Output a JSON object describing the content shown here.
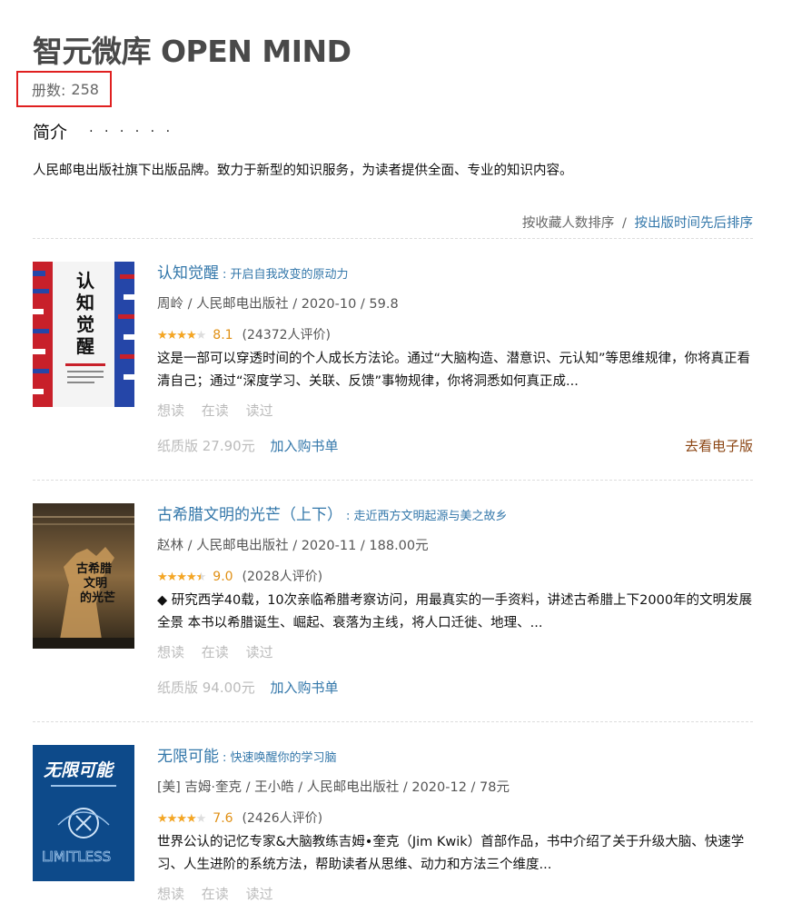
{
  "header": {
    "title": "智元微库 OPEN MIND",
    "count_label": "册数:",
    "count_value": "258",
    "intro_label": "简介",
    "intro_more": "· · · · · ·",
    "description": "人民邮电出版社旗下出版品牌。致力于新型的知识服务，为读者提供全面、专业的知识内容。"
  },
  "sort": {
    "option_1": "按收藏人数排序",
    "separator": "/",
    "option_2": "按出版时间先后排序"
  },
  "books": [
    {
      "title": "认知觉醒",
      "subtitle": ": 开启自我改变的原动力",
      "pub": "周岭 / 人民邮电出版社 / 2020-10 / 59.8",
      "stars": 4,
      "score": "8.1",
      "votes": "(24372人评价)",
      "intro": "这是一部可以穿透时间的个人成长方法论。通过“大脑构造、潜意识、元认知”等思维规律，你将真正看清自己；通过“深度学习、关联、反馈”事物规律，你将洞悉如何真正成...",
      "actions": [
        "想读",
        "在读",
        "读过"
      ],
      "paper": "纸质版 27.90元",
      "cart": "加入购书单",
      "ebook": "去看电子版",
      "cover_text": "认知觉醒"
    },
    {
      "title": "古希腊文明的光芒（上下）",
      "subtitle": ": 走近西方文明起源与美之故乡",
      "pub": "赵林 / 人民邮电出版社 / 2020-11 / 188.00元",
      "stars": 4.5,
      "score": "9.0",
      "votes": "(2028人评价)",
      "intro": "◆ 研究西学40载，10次亲临希腊考察访问，用最真实的一手资料，讲述古希腊上下2000年的文明发展全景 本书以希腊诞生、崛起、衰落为主线，将人口迁徙、地理、...",
      "actions": [
        "想读",
        "在读",
        "读过"
      ],
      "paper": "纸质版 94.00元",
      "cart": "加入购书单",
      "cover_text": "古希腊文明的光芒"
    },
    {
      "title": "无限可能",
      "subtitle": ": 快速唤醒你的学习脑",
      "pub": "[美] 吉姆·奎克 / 王小皓 / 人民邮电出版社 / 2020-12 / 78元",
      "stars": 4,
      "score": "7.6",
      "votes": "(2426人评价)",
      "intro": "世界公认的记忆专家&大脑教练吉姆•奎克（Jim Kwik）首部作品，书中介绍了关于升级大脑、快速学习、人生进阶的系统方法，帮助读者从思维、动力和方法三个维度...",
      "actions": [
        "想读",
        "在读",
        "读过"
      ],
      "cover_text": "无限可能",
      "cover_text_2": "LIMITLESS"
    }
  ],
  "colors": {
    "link": "#3377aa",
    "star": "#f5a623",
    "score": "#e09015",
    "highlight_box": "#e02020",
    "ebook": "#8b4513"
  }
}
